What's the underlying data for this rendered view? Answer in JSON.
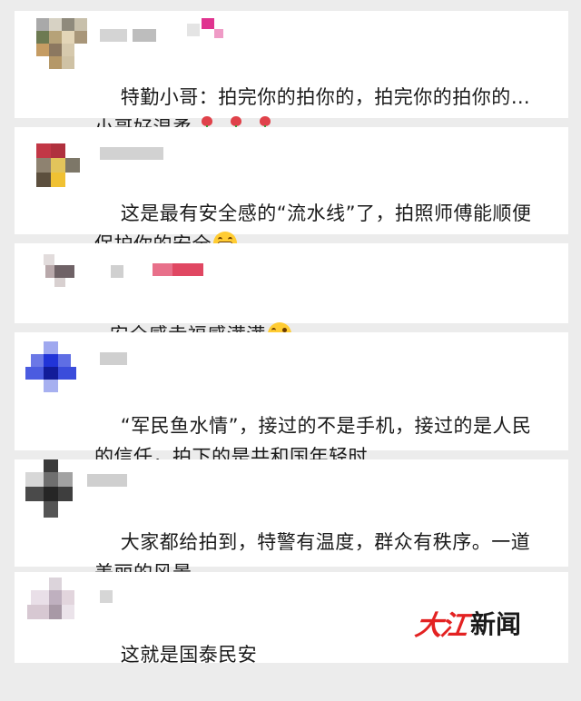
{
  "comments": [
    {
      "name": "",
      "text": "特勤小哥：拍完你的拍你的，拍完你的拍你的…\n小哥好温柔",
      "emoji": "rose"
    },
    {
      "name": "",
      "text": "这是最有安全感的“流水线”了，拍照师傅能顺便\n保护你的安全",
      "emoji": "grin"
    },
    {
      "name": "",
      "text": "安全感幸福感满满",
      "emoji": "wink"
    },
    {
      "name": "",
      "text": "“军民鱼水情”，接过的不是手机，接过的是人民\n的信任，拍下的是共和国年轻时",
      "emoji": ""
    },
    {
      "name": "",
      "text": "大家都给拍到，特警有温度，群众有秩序。一道\n美丽的风景。",
      "emoji": ""
    },
    {
      "name": "",
      "text": "这就是国泰民安",
      "emoji": ""
    }
  ],
  "watermark": {
    "brand_red": "大江",
    "brand_black": "新闻",
    "red": "#e32222"
  }
}
